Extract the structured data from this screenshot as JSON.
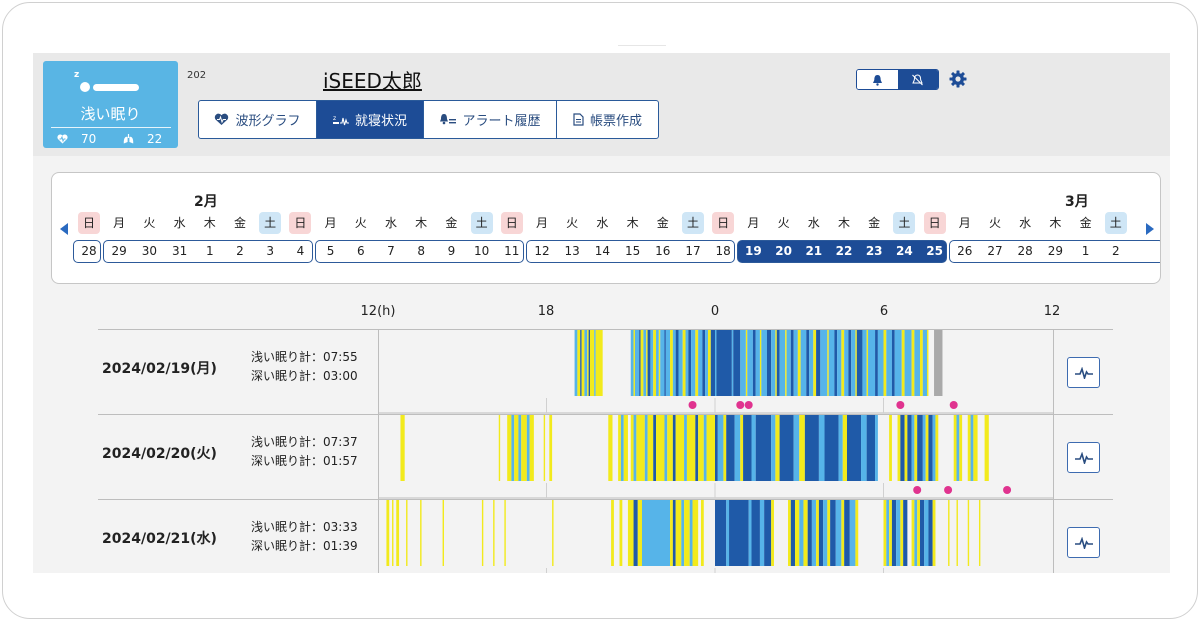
{
  "patient": {
    "room": "202",
    "name": "iSEED太郎",
    "sleep_state": "浅い眠り",
    "heart_rate": "70",
    "respiration": "22"
  },
  "tabs": [
    {
      "label": "波形グラフ",
      "active": false
    },
    {
      "label": "就寝状況",
      "active": true
    },
    {
      "label": "アラート履歴",
      "active": false
    },
    {
      "label": "帳票作成",
      "active": false
    }
  ],
  "calendar": {
    "months": [
      "2月",
      "3月"
    ],
    "weekdays": [
      "日",
      "月",
      "火",
      "水",
      "木",
      "金",
      "土",
      "日",
      "月",
      "火",
      "水",
      "木",
      "金",
      "土",
      "日",
      "月",
      "火",
      "水",
      "木",
      "金",
      "土",
      "日",
      "月",
      "火",
      "水",
      "木",
      "金",
      "土",
      "日",
      "月",
      "火",
      "水",
      "木",
      "金",
      "土"
    ],
    "dates": [
      "28",
      "29",
      "30",
      "31",
      "1",
      "2",
      "3",
      "4",
      "5",
      "6",
      "7",
      "8",
      "9",
      "10",
      "11",
      "12",
      "13",
      "14",
      "15",
      "16",
      "17",
      "18",
      "19",
      "20",
      "21",
      "22",
      "23",
      "24",
      "25",
      "26",
      "27",
      "28",
      "29",
      "1",
      "2"
    ],
    "selected_week_start": "19",
    "selected_week_end": "25"
  },
  "chart": {
    "axis_labels": [
      "12(h)",
      "18",
      "0",
      "6",
      "12"
    ],
    "legend_colors": {
      "awake": "#f2ea1c",
      "light": "#56b4e9",
      "deep": "#1f5aa8",
      "absent": "#a9a9a9",
      "alert": "#e0338f"
    },
    "rows": [
      {
        "date": "2024/02/19(月)",
        "light_label": "浅い眠り計：07:55",
        "deep_label": "深い眠り計：03:00",
        "segments": [
          [
            19.0,
            "light"
          ],
          [
            19.1,
            "awake"
          ],
          [
            19.2,
            "deep"
          ],
          [
            19.25,
            "awake"
          ],
          [
            19.35,
            "light"
          ],
          [
            19.45,
            "awake"
          ],
          [
            19.5,
            "deep"
          ],
          [
            19.55,
            "awake"
          ],
          [
            19.7,
            "light"
          ],
          [
            19.75,
            "awake"
          ],
          [
            20.0,
            "none"
          ],
          [
            21.0,
            "light"
          ],
          [
            21.1,
            "awake"
          ],
          [
            21.15,
            "light"
          ],
          [
            21.3,
            "deep"
          ],
          [
            21.35,
            "awake"
          ],
          [
            21.45,
            "light"
          ],
          [
            21.55,
            "awake"
          ],
          [
            21.6,
            "deep"
          ],
          [
            21.7,
            "light"
          ],
          [
            21.8,
            "awake"
          ],
          [
            21.9,
            "light"
          ],
          [
            22.0,
            "awake"
          ],
          [
            22.05,
            "light"
          ],
          [
            22.2,
            "deep"
          ],
          [
            22.25,
            "light"
          ],
          [
            22.4,
            "awake"
          ],
          [
            22.5,
            "light"
          ],
          [
            22.6,
            "deep"
          ],
          [
            22.7,
            "light"
          ],
          [
            22.85,
            "awake"
          ],
          [
            22.95,
            "light"
          ],
          [
            23.05,
            "deep"
          ],
          [
            23.15,
            "light"
          ],
          [
            23.3,
            "awake"
          ],
          [
            23.4,
            "light"
          ],
          [
            23.55,
            "deep"
          ],
          [
            23.65,
            "light"
          ],
          [
            23.75,
            "awake"
          ],
          [
            23.85,
            "deep"
          ],
          [
            24.0,
            "light"
          ],
          [
            24.05,
            "deep"
          ],
          [
            24.6,
            "light"
          ],
          [
            24.65,
            "deep"
          ],
          [
            24.9,
            "light"
          ],
          [
            25.1,
            "awake"
          ],
          [
            25.15,
            "light"
          ],
          [
            25.35,
            "deep"
          ],
          [
            25.45,
            "light"
          ],
          [
            25.6,
            "awake"
          ],
          [
            25.65,
            "light"
          ],
          [
            25.85,
            "deep"
          ],
          [
            26.0,
            "light"
          ],
          [
            26.15,
            "awake"
          ],
          [
            26.2,
            "deep"
          ],
          [
            26.3,
            "light"
          ],
          [
            26.5,
            "awake"
          ],
          [
            26.55,
            "light"
          ],
          [
            26.7,
            "deep"
          ],
          [
            26.8,
            "light"
          ],
          [
            26.95,
            "awake"
          ],
          [
            27.05,
            "light"
          ],
          [
            27.25,
            "deep"
          ],
          [
            27.35,
            "light"
          ],
          [
            27.5,
            "awake"
          ],
          [
            27.6,
            "deep"
          ],
          [
            27.75,
            "light"
          ],
          [
            28.0,
            "awake"
          ],
          [
            28.05,
            "light"
          ],
          [
            28.25,
            "deep"
          ],
          [
            28.35,
            "light"
          ],
          [
            28.5,
            "awake"
          ],
          [
            28.6,
            "light"
          ],
          [
            28.75,
            "deep"
          ],
          [
            28.85,
            "light"
          ],
          [
            29.0,
            "awake"
          ],
          [
            29.05,
            "deep"
          ],
          [
            29.25,
            "light"
          ],
          [
            29.4,
            "awake"
          ],
          [
            29.45,
            "light"
          ],
          [
            29.7,
            "deep"
          ],
          [
            29.8,
            "light"
          ],
          [
            30.0,
            "awake"
          ],
          [
            30.1,
            "light"
          ],
          [
            30.3,
            "deep"
          ],
          [
            30.4,
            "light"
          ],
          [
            30.65,
            "awake"
          ],
          [
            30.75,
            "light"
          ],
          [
            31.0,
            "awake"
          ],
          [
            31.1,
            "light"
          ],
          [
            31.3,
            "awake"
          ],
          [
            31.4,
            "light"
          ],
          [
            31.55,
            "awake"
          ],
          [
            31.6,
            "none"
          ],
          [
            31.8,
            "absent"
          ],
          [
            32.1,
            "none"
          ]
        ],
        "alerts": [
          23.2,
          24.9,
          25.2,
          30.6,
          32.5
        ]
      },
      {
        "date": "2024/02/20(火)",
        "light_label": "浅い眠り計：07:37",
        "deep_label": "深い眠り計：01:57",
        "segments": [
          [
            12.8,
            "awake"
          ],
          [
            12.95,
            "none"
          ],
          [
            16.3,
            "awake"
          ],
          [
            16.35,
            "none"
          ],
          [
            16.6,
            "awake"
          ],
          [
            16.75,
            "light"
          ],
          [
            16.85,
            "awake"
          ],
          [
            17.0,
            "light"
          ],
          [
            17.1,
            "awake"
          ],
          [
            17.3,
            "light"
          ],
          [
            17.4,
            "awake"
          ],
          [
            17.55,
            "none"
          ],
          [
            17.9,
            "awake"
          ],
          [
            17.95,
            "none"
          ],
          [
            18.1,
            "awake"
          ],
          [
            18.2,
            "none"
          ],
          [
            20.2,
            "awake"
          ],
          [
            20.35,
            "none"
          ],
          [
            20.55,
            "awake"
          ],
          [
            20.65,
            "light"
          ],
          [
            20.75,
            "awake"
          ],
          [
            20.9,
            "none"
          ],
          [
            21.0,
            "awake"
          ],
          [
            21.1,
            "light"
          ],
          [
            21.2,
            "awake"
          ],
          [
            21.5,
            "light"
          ],
          [
            21.6,
            "awake"
          ],
          [
            21.8,
            "deep"
          ],
          [
            21.9,
            "awake"
          ],
          [
            22.2,
            "light"
          ],
          [
            22.3,
            "awake"
          ],
          [
            22.5,
            "deep"
          ],
          [
            22.6,
            "awake"
          ],
          [
            22.9,
            "light"
          ],
          [
            23.0,
            "awake"
          ],
          [
            23.3,
            "deep"
          ],
          [
            23.4,
            "awake"
          ],
          [
            23.6,
            "light"
          ],
          [
            23.7,
            "awake"
          ],
          [
            24.0,
            "deep"
          ],
          [
            24.1,
            "light"
          ],
          [
            24.3,
            "awake"
          ],
          [
            24.4,
            "deep"
          ],
          [
            24.7,
            "light"
          ],
          [
            24.9,
            "awake"
          ],
          [
            25.0,
            "deep"
          ],
          [
            25.3,
            "light"
          ],
          [
            25.45,
            "deep"
          ],
          [
            26.0,
            "light"
          ],
          [
            26.15,
            "awake"
          ],
          [
            26.3,
            "deep"
          ],
          [
            26.8,
            "light"
          ],
          [
            27.0,
            "awake"
          ],
          [
            27.2,
            "deep"
          ],
          [
            27.7,
            "light"
          ],
          [
            27.9,
            "deep"
          ],
          [
            28.4,
            "light"
          ],
          [
            28.55,
            "awake"
          ],
          [
            28.7,
            "deep"
          ],
          [
            29.2,
            "light"
          ],
          [
            29.4,
            "deep"
          ],
          [
            29.7,
            "light"
          ],
          [
            29.8,
            "none"
          ],
          [
            30.2,
            "awake"
          ],
          [
            30.3,
            "none"
          ],
          [
            30.5,
            "awake"
          ],
          [
            30.6,
            "deep"
          ],
          [
            30.75,
            "awake"
          ],
          [
            30.85,
            "deep"
          ],
          [
            31.0,
            "light"
          ],
          [
            31.1,
            "awake"
          ],
          [
            31.2,
            "deep"
          ],
          [
            31.4,
            "light"
          ],
          [
            31.5,
            "awake"
          ],
          [
            31.6,
            "deep"
          ],
          [
            31.75,
            "light"
          ],
          [
            31.85,
            "awake"
          ],
          [
            31.95,
            "none"
          ],
          [
            32.5,
            "awake"
          ],
          [
            32.6,
            "light"
          ],
          [
            32.7,
            "awake"
          ],
          [
            32.8,
            "none"
          ],
          [
            33.0,
            "awake"
          ],
          [
            33.1,
            "light"
          ],
          [
            33.2,
            "awake"
          ],
          [
            33.35,
            "none"
          ],
          [
            33.6,
            "awake"
          ],
          [
            33.75,
            "none"
          ]
        ],
        "alerts": [
          31.2,
          32.3,
          34.4
        ]
      },
      {
        "date": "2024/02/21(水)",
        "light_label": "浅い眠り計：03:33",
        "deep_label": "深い眠り計：01:39",
        "segments": [
          [
            12.3,
            "awake"
          ],
          [
            12.4,
            "none"
          ],
          [
            12.5,
            "awake"
          ],
          [
            12.55,
            "none"
          ],
          [
            12.65,
            "awake"
          ],
          [
            12.75,
            "none"
          ],
          [
            13.0,
            "awake"
          ],
          [
            13.05,
            "none"
          ],
          [
            13.5,
            "awake"
          ],
          [
            13.55,
            "none"
          ],
          [
            14.3,
            "awake"
          ],
          [
            14.35,
            "none"
          ],
          [
            15.7,
            "awake"
          ],
          [
            15.75,
            "none"
          ],
          [
            16.1,
            "awake"
          ],
          [
            16.15,
            "none"
          ],
          [
            16.5,
            "awake"
          ],
          [
            16.55,
            "none"
          ],
          [
            18.2,
            "awake"
          ],
          [
            18.25,
            "none"
          ],
          [
            20.3,
            "awake"
          ],
          [
            20.4,
            "none"
          ],
          [
            20.6,
            "awake"
          ],
          [
            20.7,
            "none"
          ],
          [
            20.9,
            "awake"
          ],
          [
            21.1,
            "deep"
          ],
          [
            21.25,
            "awake"
          ],
          [
            21.4,
            "light"
          ],
          [
            22.4,
            "awake"
          ],
          [
            22.5,
            "deep"
          ],
          [
            22.6,
            "awake"
          ],
          [
            22.8,
            "light"
          ],
          [
            22.9,
            "awake"
          ],
          [
            23.1,
            "light"
          ],
          [
            23.2,
            "awake"
          ],
          [
            23.4,
            "none"
          ],
          [
            23.5,
            "awake"
          ],
          [
            23.6,
            "none"
          ],
          [
            24.0,
            "deep"
          ],
          [
            24.4,
            "light"
          ],
          [
            24.5,
            "deep"
          ],
          [
            25.2,
            "light"
          ],
          [
            25.3,
            "deep"
          ],
          [
            25.6,
            "light"
          ],
          [
            25.75,
            "deep"
          ],
          [
            26.0,
            "awake"
          ],
          [
            26.1,
            "none"
          ],
          [
            26.6,
            "awake"
          ],
          [
            26.7,
            "deep"
          ],
          [
            26.85,
            "awake"
          ],
          [
            27.0,
            "light"
          ],
          [
            27.15,
            "awake"
          ],
          [
            27.3,
            "deep"
          ],
          [
            27.45,
            "light"
          ],
          [
            27.6,
            "awake"
          ],
          [
            27.7,
            "deep"
          ],
          [
            27.85,
            "light"
          ],
          [
            28.0,
            "awake"
          ],
          [
            28.1,
            "deep"
          ],
          [
            28.3,
            "light"
          ],
          [
            28.5,
            "awake"
          ],
          [
            28.6,
            "deep"
          ],
          [
            28.8,
            "light"
          ],
          [
            29.0,
            "awake"
          ],
          [
            29.1,
            "none"
          ],
          [
            30.0,
            "awake"
          ],
          [
            30.1,
            "light"
          ],
          [
            30.2,
            "awake"
          ],
          [
            30.3,
            "deep"
          ],
          [
            30.45,
            "light"
          ],
          [
            30.6,
            "awake"
          ],
          [
            30.7,
            "deep"
          ],
          [
            30.85,
            "none"
          ],
          [
            31.0,
            "awake"
          ],
          [
            31.1,
            "light"
          ],
          [
            31.2,
            "awake"
          ],
          [
            31.3,
            "deep"
          ],
          [
            31.45,
            "light"
          ],
          [
            31.6,
            "deep"
          ],
          [
            31.75,
            "awake"
          ],
          [
            31.85,
            "none"
          ],
          [
            32.3,
            "awake"
          ],
          [
            32.35,
            "none"
          ],
          [
            32.6,
            "awake"
          ],
          [
            32.65,
            "none"
          ],
          [
            33.0,
            "awake"
          ],
          [
            33.05,
            "none"
          ],
          [
            33.4,
            "awake"
          ],
          [
            33.45,
            "none"
          ]
        ],
        "alerts": []
      }
    ]
  }
}
